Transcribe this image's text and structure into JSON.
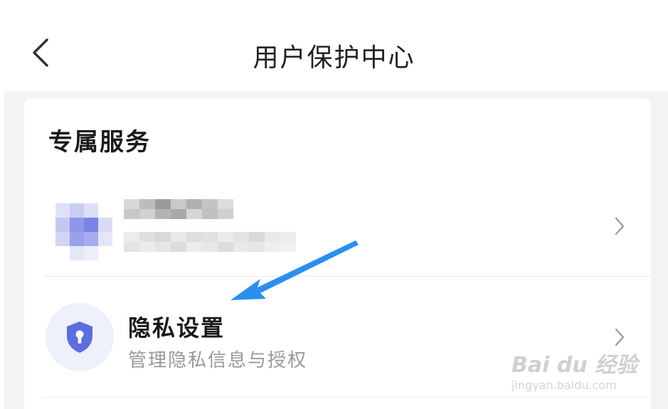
{
  "header": {
    "title": "用户保护中心"
  },
  "section": {
    "title": "专属服务"
  },
  "privacy_item": {
    "title": "隐私设置",
    "subtitle": "管理隐私信息与授权"
  },
  "watermark": {
    "brand": "Bai du 经验",
    "url": "jingyan.baidu.com"
  },
  "colors": {
    "accent": "#5b6de0",
    "annotation_arrow": "#2b8ff0",
    "page_bg": "#f2f3f5"
  },
  "icons": {
    "back": "chevron-left-icon",
    "chevron": "chevron-right-icon",
    "privacy": "shield-lock-icon"
  }
}
